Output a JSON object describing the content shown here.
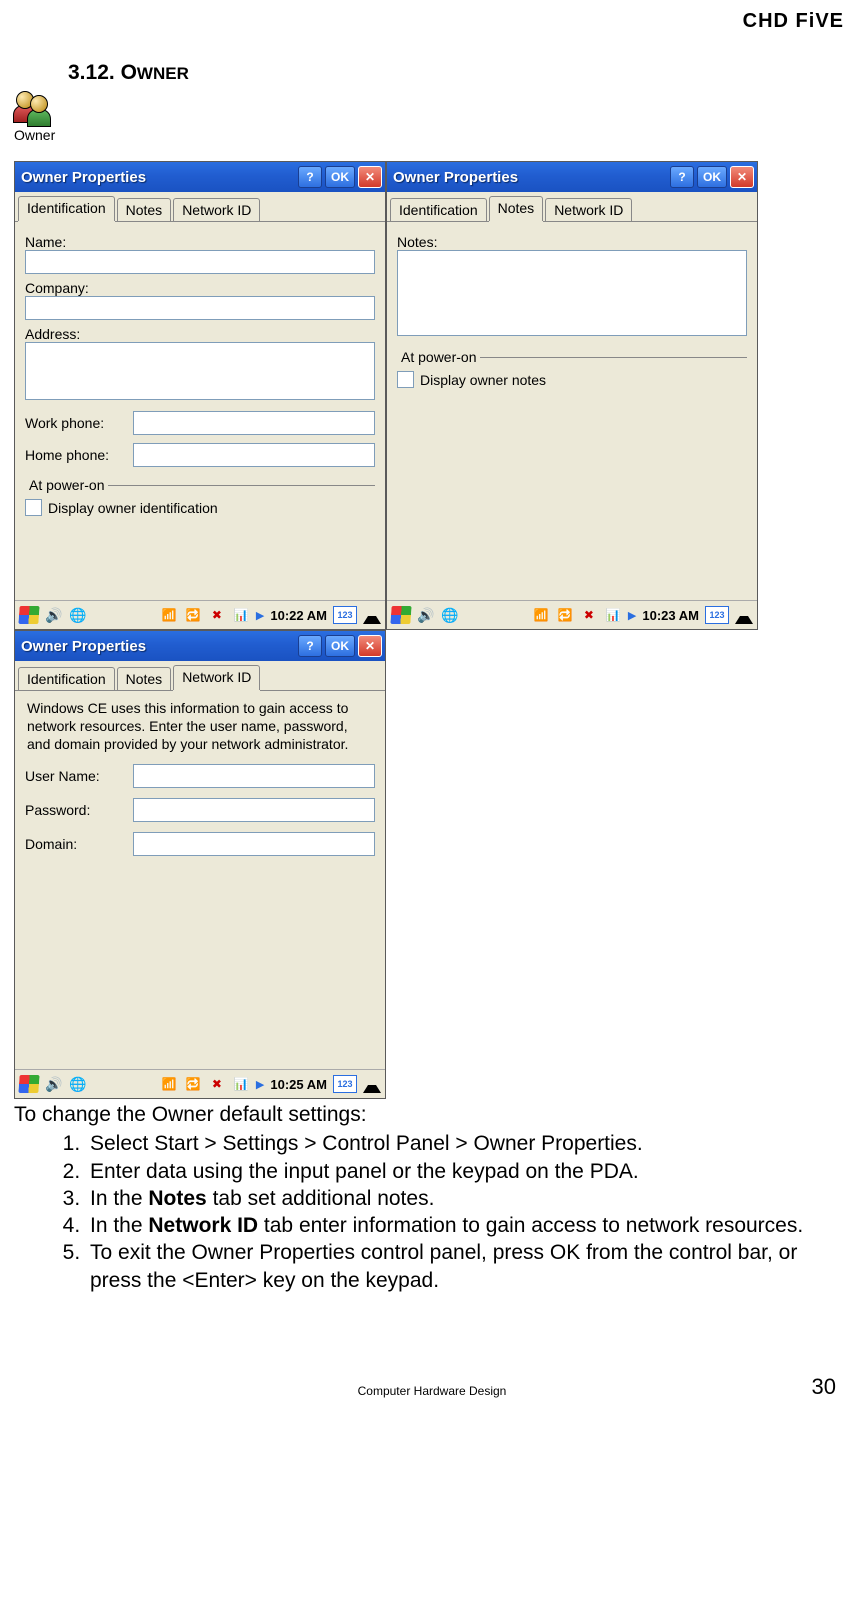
{
  "brand": "CHD FiVE",
  "section": {
    "num": "3.12.",
    "title_sc": "OWNER"
  },
  "owner_label": "Owner",
  "windows": {
    "title": "Owner Properties",
    "help": "?",
    "ok": "OK",
    "tabs": {
      "id": "Identification",
      "notes": "Notes",
      "net": "Network ID"
    }
  },
  "id_tab": {
    "name": "Name:",
    "company": "Company:",
    "address": "Address:",
    "work": "Work phone:",
    "home": "Home phone:",
    "poweron": "At power-on",
    "checkbox": "Display owner identification"
  },
  "notes_tab": {
    "notes": "Notes:",
    "poweron": "At power-on",
    "checkbox": "Display owner notes"
  },
  "net_tab": {
    "desc": "Windows CE uses this information to gain access to network resources. Enter the user name, password, and domain provided by your network administrator.",
    "user": "User Name:",
    "pass": "Password:",
    "domain": "Domain:"
  },
  "taskbar": {
    "time1": "10:22 AM",
    "time2": "10:23 AM",
    "time3": "10:25 AM",
    "kbd": "123"
  },
  "instructions": {
    "intro": "To change the Owner default settings:",
    "s1": "Select Start > Settings > Control Panel > Owner Properties.",
    "s2": "Enter data using the input panel or the keypad on the PDA.",
    "s3a": "In the ",
    "s3b": "Notes",
    "s3c": " tab set additional notes.",
    "s4a": "In the ",
    "s4b": "Network ID",
    "s4c": " tab enter information to gain access to network resources.",
    "s5": "To exit the Owner Properties control panel, press OK from the control bar, or press the <Enter> key on the keypad."
  },
  "footer": "Computer Hardware Design",
  "page_num": "30"
}
